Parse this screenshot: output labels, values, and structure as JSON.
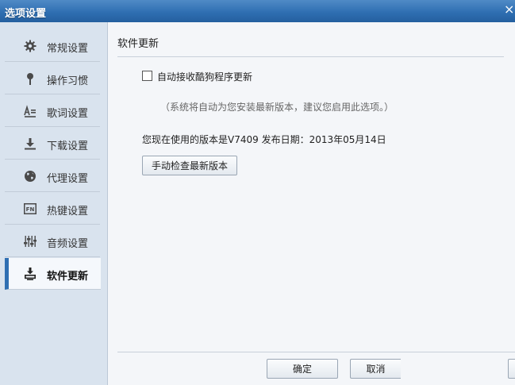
{
  "window": {
    "title": "选项设置",
    "close_glyph": "×"
  },
  "sidebar": {
    "items": [
      {
        "label": "常规设置",
        "icon": "gear-icon"
      },
      {
        "label": "操作习惯",
        "icon": "pin-icon"
      },
      {
        "label": "歌词设置",
        "icon": "lyrics-icon"
      },
      {
        "label": "下载设置",
        "icon": "download-icon"
      },
      {
        "label": "代理设置",
        "icon": "globe-icon"
      },
      {
        "label": "热键设置",
        "icon": "hotkey-icon",
        "icon_text": "FN"
      },
      {
        "label": "音频设置",
        "icon": "equalizer-icon"
      },
      {
        "label": "软件更新",
        "icon": "update-icon",
        "active": true
      }
    ]
  },
  "main": {
    "section_title": "软件更新",
    "auto_update": {
      "label": "自动接收酷狗程序更新",
      "checked": false
    },
    "hint": "（系统将自动为您安装最新版本，建议您启用此选项。）",
    "version_text": "您现在使用的版本是V7409 发布日期：2013年05月14日",
    "check_button": "手动检查最新版本"
  },
  "footer": {
    "ok_label": "确定",
    "cancel_label": "取消"
  },
  "colors": {
    "accent": "#2f6fb2",
    "titlebar": "#2f6fb2",
    "sidebar_bg": "#d9e3ee",
    "content_bg": "#f4f6f9"
  }
}
